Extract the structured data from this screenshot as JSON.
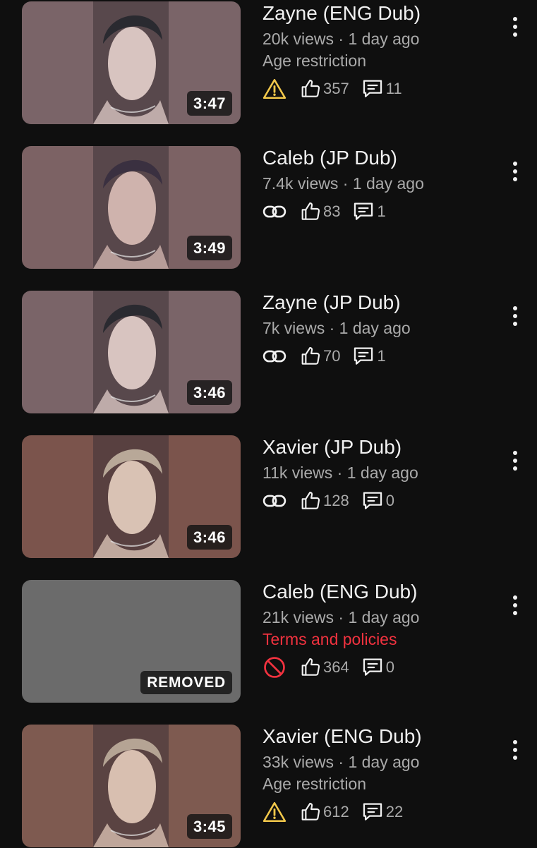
{
  "videos": [
    {
      "title": "Zayne (ENG Dub)",
      "views": "20k views",
      "separator": "·",
      "age": "1 day ago",
      "restriction": "Age restriction",
      "restriction_style": "grey",
      "status_icon": "warning-icon",
      "likes": "357",
      "comments": "11",
      "duration": "3:47",
      "thumb_bg": "#7a6468",
      "thumb_skin": "#d8c4c0",
      "thumb_hair": "#2a2a30",
      "removed": false
    },
    {
      "title": "Caleb (JP Dub)",
      "views": "7.4k views",
      "separator": "·",
      "age": "1 day ago",
      "restriction": "",
      "restriction_style": "grey",
      "status_icon": "link-icon",
      "likes": "83",
      "comments": "1",
      "duration": "3:49",
      "thumb_bg": "#7c6264",
      "thumb_skin": "#cfb3ad",
      "thumb_hair": "#3a3040",
      "removed": false
    },
    {
      "title": "Zayne (JP Dub)",
      "views": "7k views",
      "separator": "·",
      "age": "1 day ago",
      "restriction": "",
      "restriction_style": "grey",
      "status_icon": "link-icon",
      "likes": "70",
      "comments": "1",
      "duration": "3:46",
      "thumb_bg": "#7a6468",
      "thumb_skin": "#d8c4c0",
      "thumb_hair": "#2a2a30",
      "removed": false
    },
    {
      "title": "Xavier (JP Dub)",
      "views": "11k views",
      "separator": "·",
      "age": "1 day ago",
      "restriction": "",
      "restriction_style": "grey",
      "status_icon": "link-icon",
      "likes": "128",
      "comments": "0",
      "duration": "3:46",
      "thumb_bg": "#7b544c",
      "thumb_skin": "#d9c2b4",
      "thumb_hair": "#b8a898",
      "removed": false
    },
    {
      "title": "Caleb (ENG Dub)",
      "views": "21k views",
      "separator": "·",
      "age": "1 day ago",
      "restriction": "Terms and policies",
      "restriction_style": "red",
      "status_icon": "blocked-icon",
      "likes": "364",
      "comments": "0",
      "duration": "REMOVED",
      "thumb_bg": "#6b6b6b",
      "thumb_skin": "",
      "thumb_hair": "",
      "removed": true
    },
    {
      "title": "Xavier (ENG Dub)",
      "views": "33k views",
      "separator": "·",
      "age": "1 day ago",
      "restriction": "Age restriction",
      "restriction_style": "grey",
      "status_icon": "warning-icon",
      "likes": "612",
      "comments": "22",
      "duration": "3:45",
      "thumb_bg": "#7e5a50",
      "thumb_skin": "#d8bfb0",
      "thumb_hair": "#b5a494",
      "removed": false
    }
  ],
  "colors": {
    "background": "#0f0f0f",
    "text_primary": "#f1f1f1",
    "text_secondary": "#aaaaaa",
    "warning": "#f2c84b",
    "error": "#f2323f"
  }
}
